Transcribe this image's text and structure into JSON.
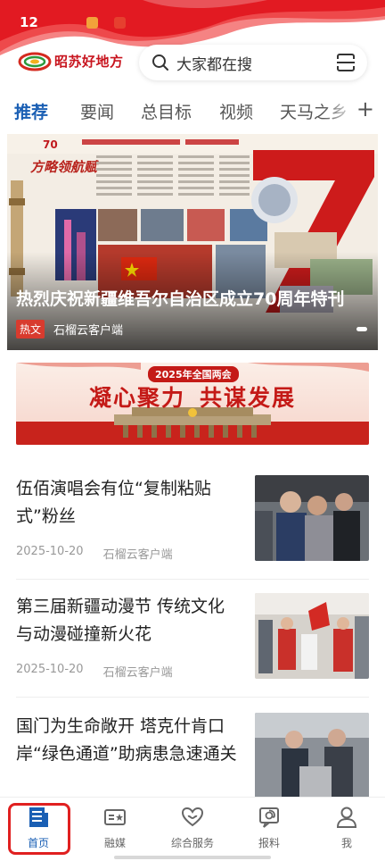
{
  "status_bar": {
    "time": "12"
  },
  "header": {
    "logo_text": "昭苏好地方",
    "search_placeholder": "大家都在搜"
  },
  "tabs": [
    {
      "label": "推荐",
      "active": true
    },
    {
      "label": "要闻",
      "active": false
    },
    {
      "label": "总目标",
      "active": false
    },
    {
      "label": "视频",
      "active": false
    },
    {
      "label": "天马之乡",
      "active": false
    }
  ],
  "tab_add_label": "+",
  "hero": {
    "title": "热烈庆祝新疆维吾尔自治区成立70周年特刊",
    "tag": "热文",
    "source": "石榴云客户端",
    "badge_number": "70",
    "slogan": "方略领航赋"
  },
  "sub_banner": {
    "year_label": "2025年全国两会",
    "title_left": "凝心聚力",
    "title_right": "共谋发展"
  },
  "news": [
    {
      "title": "伍佰演唱会有位“复制粘贴式”粉丝",
      "date": "2025-10-20",
      "source": "石榴云客户端"
    },
    {
      "title": "第三届新疆动漫节 传统文化与动漫碰撞新火花",
      "date": "2025-10-20",
      "source": "石榴云客户端"
    },
    {
      "title": "国门为生命敞开 塔克什肯口岸“绿色通道”助病患急速通关",
      "date": "",
      "source": ""
    }
  ],
  "bottom_nav": [
    {
      "label": "首页",
      "icon": "news-icon",
      "active": true
    },
    {
      "label": "融媒",
      "icon": "media-icon",
      "active": false
    },
    {
      "label": "综合服务",
      "icon": "heart-hands-icon",
      "active": false
    },
    {
      "label": "报料",
      "icon": "report-icon",
      "active": false
    },
    {
      "label": "我",
      "icon": "user-icon",
      "active": false
    }
  ],
  "colors": {
    "accent_blue": "#1a5fb4",
    "brand_red": "#c8141e",
    "highlight_red": "#e02020"
  }
}
